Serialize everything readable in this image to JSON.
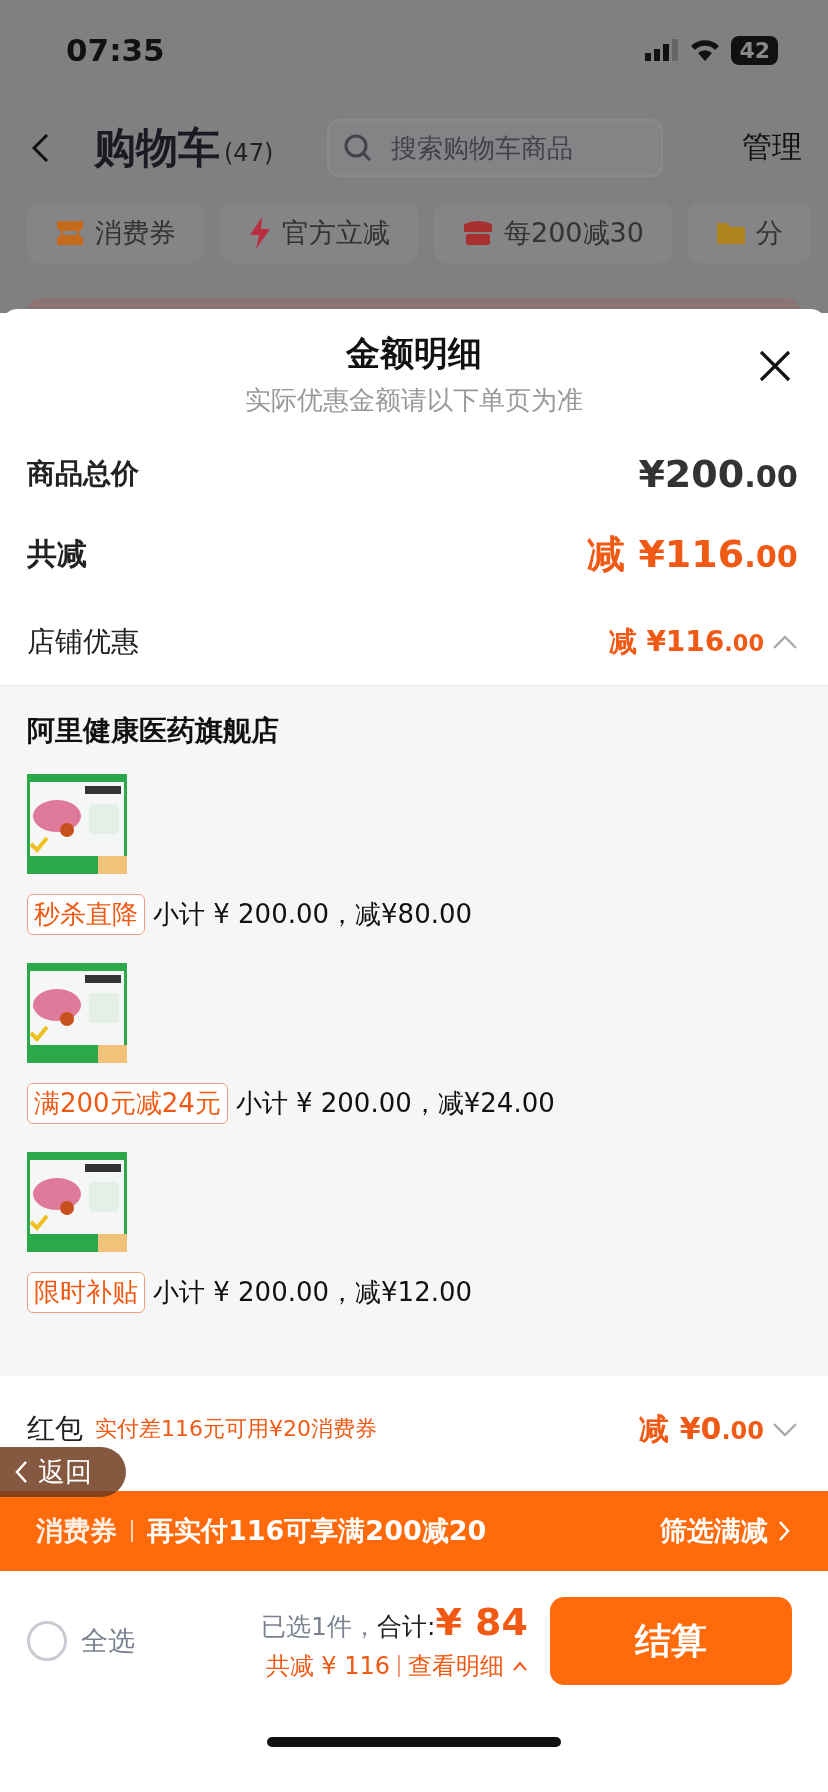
{
  "status_bar": {
    "time": "07:35",
    "battery": "42"
  },
  "header": {
    "title": "购物车",
    "count": "(47)",
    "search": {
      "placeholder": "搜索购物车商品"
    },
    "action": "管理"
  },
  "chips": [
    {
      "label": "消费券"
    },
    {
      "label": "官方立减"
    },
    {
      "label": "每200减30"
    },
    {
      "label": "分"
    }
  ],
  "sheet": {
    "title": "金额明细",
    "subtitle": "实际优惠金额请以下单页为准",
    "rows": [
      {
        "kind": "total",
        "label": "商品总价",
        "value": "¥200.00"
      },
      {
        "kind": "discount",
        "label": "共减",
        "value": "减 ¥116.00"
      },
      {
        "kind": "store",
        "label": "店铺优惠",
        "value": "减 ¥116.00",
        "expanded": true
      }
    ],
    "store": {
      "name": "阿里健康医药旗舰店",
      "items": [
        {
          "kind": "picture",
          "tag": "秒杀直降",
          "detail": "小计 ¥ 200.00，减¥80.00"
        },
        {
          "kind": "picture",
          "tag": "满200元减24元",
          "detail": "小计 ¥ 200.00，减¥24.00"
        },
        {
          "kind": "picture",
          "tag": "限时补贴",
          "detail": "小计 ¥ 200.00，减¥12.00"
        }
      ]
    },
    "red_packet": {
      "label": "红包",
      "hint": "实付差116元可用¥20消费券",
      "value": "减 ¥0.00",
      "expanded": false
    }
  },
  "promo_bar": {
    "label": "消费券",
    "message": "再实付116可享满200减20",
    "action": "筛选满减"
  },
  "back_pill": {
    "label": "返回"
  },
  "checkout": {
    "select_all": {
      "label": "全选",
      "checked": false
    },
    "selected": "已选1件，",
    "total_label": "合计:",
    "total": "¥ 84",
    "saving": "共减 ¥ 116",
    "detail_link": "查看明细",
    "button": "结算"
  }
}
